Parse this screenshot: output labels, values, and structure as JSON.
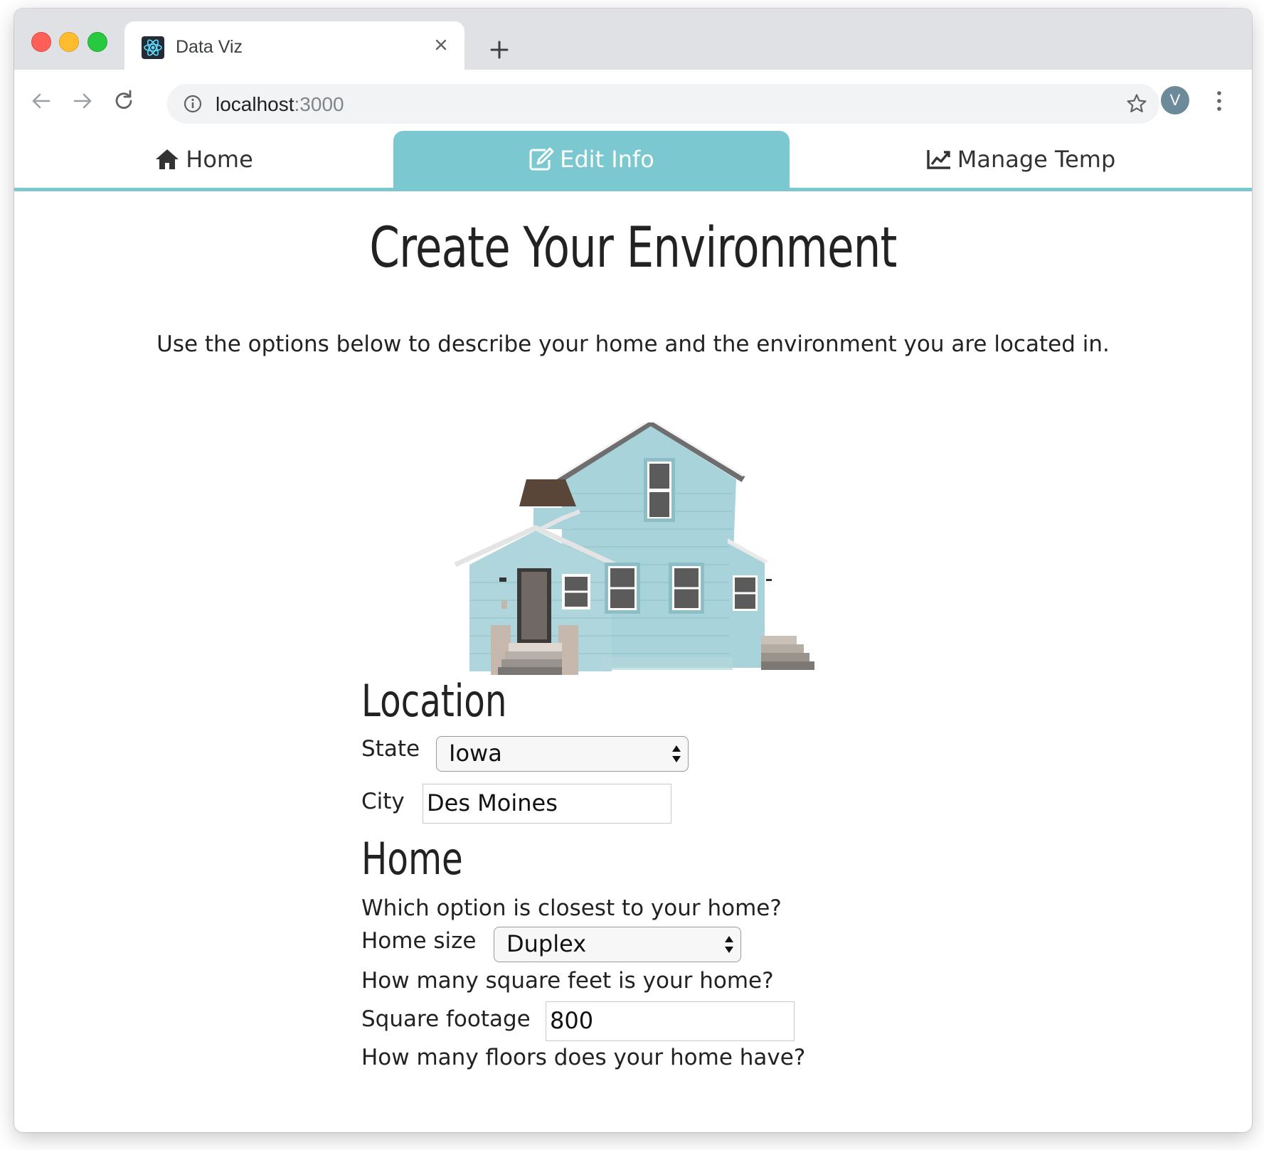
{
  "browser": {
    "tab_title": "Data Viz",
    "url_host": "localhost",
    "url_port": ":3000",
    "profile_initial": "V"
  },
  "nav": {
    "home": "Home",
    "edit_info": "Edit Info",
    "manage_temp": "Manage Temp",
    "active_tab": "Edit Info"
  },
  "page": {
    "title": "Create Your Environment",
    "intro": "Use the options below to describe your home and the environment you are located in."
  },
  "location": {
    "heading": "Location",
    "state_label": "State",
    "state_value": "Iowa",
    "city_label": "City",
    "city_value": "Des Moines"
  },
  "home": {
    "heading": "Home",
    "size_question": "Which option is closest to your home?",
    "size_label": "Home size",
    "size_value": "Duplex",
    "sqft_question": "How many square feet is your home?",
    "sqft_label": "Square footage",
    "sqft_value": "800",
    "floors_question": "How many floors does your home have?"
  },
  "colors": {
    "accent": "#7bc8d0",
    "house_siding": "#a9d3da",
    "roof": "#5a4638"
  },
  "icons": [
    "react-icon",
    "close-icon",
    "plus-icon",
    "back-icon",
    "forward-icon",
    "reload-icon",
    "info-icon",
    "star-icon",
    "kebab-menu-icon",
    "home-icon",
    "edit-icon",
    "line-chart-icon",
    "select-arrows-icon"
  ]
}
